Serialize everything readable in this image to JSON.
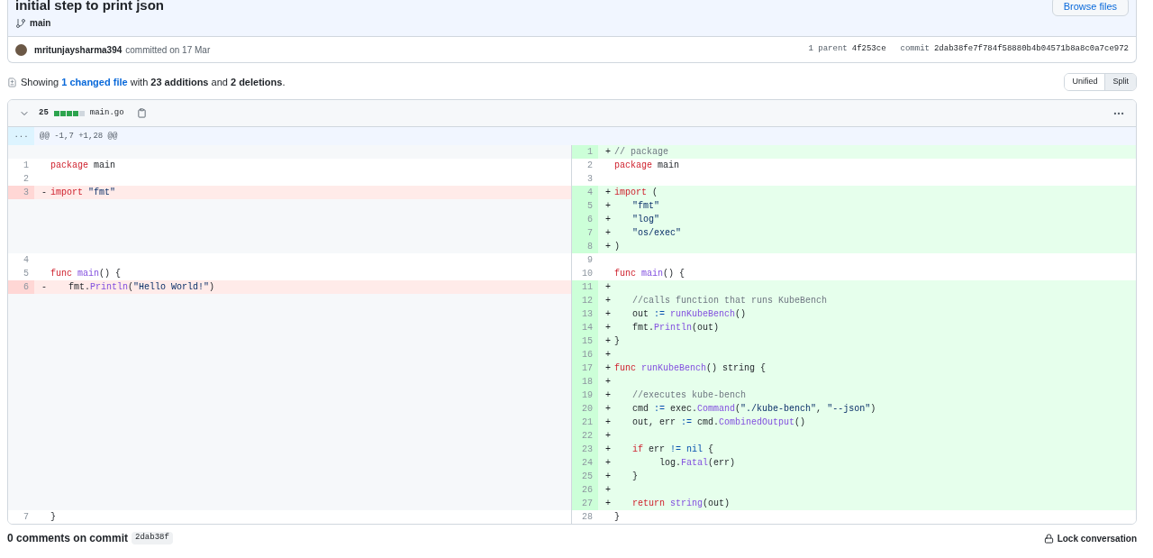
{
  "commit": {
    "title": "initial step to print json",
    "branch": "main",
    "browse_button": "Browse files",
    "author": "mritunjaysharma394",
    "action": "committed on 17 Mar",
    "parent_label": "1 parent",
    "parent_sha": "4f253ce",
    "commit_label": "commit",
    "sha": "2dab38fe7f784f58880b4b04571b8a8c0a7ce972"
  },
  "summary": {
    "prefix": "Showing",
    "link": "1 changed file",
    "suffix": "with **23 additions** and **2 deletions**."
  },
  "view_toggle": [
    {
      "label": "Unified",
      "selected": false
    },
    {
      "label": "Split",
      "selected": true
    }
  ],
  "file": {
    "expanded": true,
    "changes": "25",
    "diffstat": [
      {
        "color": "#2da44e"
      },
      {
        "color": "#2da44e"
      },
      {
        "color": "#2da44e"
      },
      {
        "color": "#2da44e"
      },
      {
        "color": "#d0d7de"
      }
    ],
    "name": "main.go",
    "hunk": {
      "expander": "...",
      "header": "@@ -1,7 +1,28 @@"
    },
    "rows": [
      {
        "left": {
          "kind": "empty"
        },
        "right": {
          "kind": "addition",
          "number": "1",
          "sign": "+",
          "code": [
            {
              "kind": "comment",
              "text": "// package"
            }
          ]
        }
      },
      {
        "left": {
          "kind": "context",
          "number": "1",
          "code": [
            {
              "kind": "keyword",
              "text": "package"
            },
            {
              "kind": "plain",
              "text": " main"
            }
          ]
        },
        "right": {
          "kind": "context",
          "number": "2",
          "code": [
            {
              "kind": "keyword",
              "text": "package"
            },
            {
              "kind": "plain",
              "text": " main"
            }
          ]
        }
      },
      {
        "left": {
          "kind": "context",
          "number": "2"
        },
        "right": {
          "kind": "context",
          "number": "3"
        }
      },
      {
        "left": {
          "kind": "deletion",
          "number": "3",
          "sign": "-",
          "code": [
            {
              "kind": "keyword",
              "text": "import"
            },
            {
              "kind": "string",
              "text": " \"fmt\""
            }
          ]
        },
        "right": {
          "kind": "addition",
          "number": "4",
          "sign": "+",
          "code": [
            {
              "kind": "keyword",
              "text": "import"
            },
            {
              "kind": "plain",
              "text": " ("
            }
          ]
        }
      },
      {
        "left": {
          "kind": "empty"
        },
        "right": {
          "kind": "addition",
          "number": "5",
          "sign": "+",
          "code": [
            {
              "kind": "string",
              "text": "\t\"fmt\""
            }
          ]
        }
      },
      {
        "left": {
          "kind": "empty"
        },
        "right": {
          "kind": "addition",
          "number": "6",
          "sign": "+",
          "code": [
            {
              "kind": "string",
              "text": "\t\"log\""
            }
          ]
        }
      },
      {
        "left": {
          "kind": "empty"
        },
        "right": {
          "kind": "addition",
          "number": "7",
          "sign": "+",
          "code": [
            {
              "kind": "string",
              "text": "\t\"os/exec\""
            }
          ]
        }
      },
      {
        "left": {
          "kind": "empty"
        },
        "right": {
          "kind": "addition",
          "number": "8",
          "sign": "+",
          "code": [
            {
              "kind": "plain",
              "text": ")"
            }
          ]
        }
      },
      {
        "left": {
          "kind": "context",
          "number": "4"
        },
        "right": {
          "kind": "context",
          "number": "9"
        }
      },
      {
        "left": {
          "kind": "context",
          "number": "5",
          "code": [
            {
              "kind": "keyword",
              "text": "func"
            },
            {
              "kind": "function",
              "text": " main"
            },
            {
              "kind": "plain",
              "text": "() {"
            }
          ]
        },
        "right": {
          "kind": "context",
          "number": "10",
          "code": [
            {
              "kind": "keyword",
              "text": "func"
            },
            {
              "kind": "function",
              "text": " main"
            },
            {
              "kind": "plain",
              "text": "() {"
            }
          ]
        }
      },
      {
        "left": {
          "kind": "deletion",
          "number": "6",
          "sign": "-",
          "code": [
            {
              "kind": "plain",
              "text": "\tfmt."
            },
            {
              "kind": "function",
              "text": "Println"
            },
            {
              "kind": "plain",
              "text": "("
            },
            {
              "kind": "string",
              "text": "\"Hello World!\""
            },
            {
              "kind": "plain",
              "text": ")"
            }
          ]
        },
        "right": {
          "kind": "addition",
          "number": "11",
          "sign": "+"
        }
      },
      {
        "left": {
          "kind": "empty"
        },
        "right": {
          "kind": "addition",
          "number": "12",
          "sign": "+",
          "code": [
            {
              "kind": "comment",
              "text": "\t//calls function that runs KubeBench"
            }
          ]
        }
      },
      {
        "left": {
          "kind": "empty"
        },
        "right": {
          "kind": "addition",
          "number": "13",
          "sign": "+",
          "code": [
            {
              "kind": "plain",
              "text": "\tout "
            },
            {
              "kind": "operator",
              "text": ":="
            },
            {
              "kind": "function",
              "text": " runKubeBench"
            },
            {
              "kind": "plain",
              "text": "()"
            }
          ]
        }
      },
      {
        "left": {
          "kind": "empty"
        },
        "right": {
          "kind": "addition",
          "number": "14",
          "sign": "+",
          "code": [
            {
              "kind": "plain",
              "text": "\tfmt."
            },
            {
              "kind": "function",
              "text": "Println"
            },
            {
              "kind": "plain",
              "text": "(out)"
            }
          ]
        }
      },
      {
        "left": {
          "kind": "empty"
        },
        "right": {
          "kind": "addition",
          "number": "15",
          "sign": "+",
          "code": [
            {
              "kind": "plain",
              "text": "}"
            }
          ]
        }
      },
      {
        "left": {
          "kind": "empty"
        },
        "right": {
          "kind": "addition",
          "number": "16",
          "sign": "+"
        }
      },
      {
        "left": {
          "kind": "empty"
        },
        "right": {
          "kind": "addition",
          "number": "17",
          "sign": "+",
          "code": [
            {
              "kind": "keyword",
              "text": "func"
            },
            {
              "kind": "function",
              "text": " runKubeBench"
            },
            {
              "kind": "plain",
              "text": "() string {"
            }
          ]
        }
      },
      {
        "left": {
          "kind": "empty"
        },
        "right": {
          "kind": "addition",
          "number": "18",
          "sign": "+"
        }
      },
      {
        "left": {
          "kind": "empty"
        },
        "right": {
          "kind": "addition",
          "number": "19",
          "sign": "+",
          "code": [
            {
              "kind": "comment",
              "text": "\t//executes kube-bench"
            }
          ]
        }
      },
      {
        "left": {
          "kind": "empty"
        },
        "right": {
          "kind": "addition",
          "number": "20",
          "sign": "+",
          "code": [
            {
              "kind": "plain",
              "text": "\tcmd "
            },
            {
              "kind": "operator",
              "text": ":="
            },
            {
              "kind": "plain",
              "text": " exec."
            },
            {
              "kind": "function",
              "text": "Command"
            },
            {
              "kind": "plain",
              "text": "("
            },
            {
              "kind": "string",
              "text": "\"./kube-bench\""
            },
            {
              "kind": "plain",
              "text": ", "
            },
            {
              "kind": "string",
              "text": "\"--json\""
            },
            {
              "kind": "plain",
              "text": ")"
            }
          ]
        }
      },
      {
        "left": {
          "kind": "empty"
        },
        "right": {
          "kind": "addition",
          "number": "21",
          "sign": "+",
          "code": [
            {
              "kind": "plain",
              "text": "\tout, err "
            },
            {
              "kind": "operator",
              "text": ":="
            },
            {
              "kind": "plain",
              "text": " cmd."
            },
            {
              "kind": "function",
              "text": "CombinedOutput"
            },
            {
              "kind": "plain",
              "text": "()"
            }
          ]
        }
      },
      {
        "left": {
          "kind": "empty"
        },
        "right": {
          "kind": "addition",
          "number": "22",
          "sign": "+"
        }
      },
      {
        "left": {
          "kind": "empty"
        },
        "right": {
          "kind": "addition",
          "number": "23",
          "sign": "+",
          "code": [
            {
              "kind": "keyword",
              "text": "\tif"
            },
            {
              "kind": "plain",
              "text": " err "
            },
            {
              "kind": "operator",
              "text": "!="
            },
            {
              "kind": "operator",
              "text": " nil"
            },
            {
              "kind": "plain",
              "text": " {"
            }
          ]
        }
      },
      {
        "left": {
          "kind": "empty"
        },
        "right": {
          "kind": "addition",
          "number": "24",
          "sign": "+",
          "code": [
            {
              "kind": "plain",
              "text": "\t\tlog."
            },
            {
              "kind": "function",
              "text": "Fatal"
            },
            {
              "kind": "plain",
              "text": "(err)"
            }
          ]
        }
      },
      {
        "left": {
          "kind": "empty"
        },
        "right": {
          "kind": "addition",
          "number": "25",
          "sign": "+",
          "code": [
            {
              "kind": "plain",
              "text": "\t}"
            }
          ]
        }
      },
      {
        "left": {
          "kind": "empty"
        },
        "right": {
          "kind": "addition",
          "number": "26",
          "sign": "+"
        }
      },
      {
        "left": {
          "kind": "empty"
        },
        "right": {
          "kind": "addition",
          "number": "27",
          "sign": "+",
          "code": [
            {
              "kind": "keyword",
              "text": "\treturn"
            },
            {
              "kind": "function",
              "text": " string"
            },
            {
              "kind": "plain",
              "text": "(out)"
            }
          ]
        }
      },
      {
        "left": {
          "kind": "context",
          "number": "7",
          "code": [
            {
              "kind": "plain",
              "text": "}"
            }
          ]
        },
        "right": {
          "kind": "context",
          "number": "28",
          "code": [
            {
              "kind": "plain",
              "text": "}"
            }
          ]
        }
      }
    ]
  },
  "comments": {
    "heading": "0 comments on commit",
    "sha": "2dab38f",
    "lock": "Lock conversation"
  }
}
